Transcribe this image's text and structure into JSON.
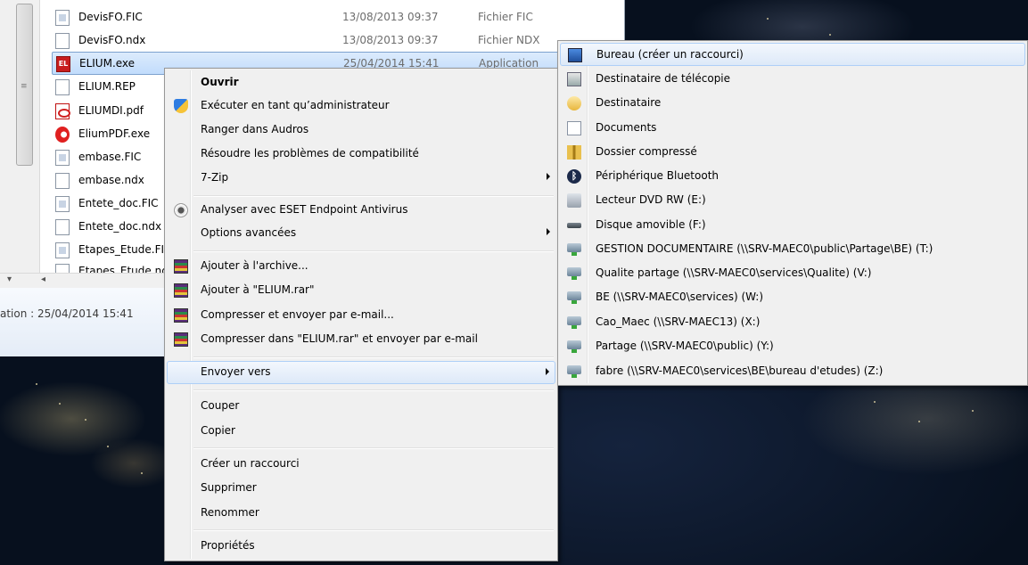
{
  "explorer": {
    "files": [
      {
        "name": "DevisFO.FIC",
        "date": "13/08/2013 09:37",
        "type": "Fichier FIC",
        "icon": "fic-file-icon"
      },
      {
        "name": "DevisFO.ndx",
        "date": "13/08/2013 09:37",
        "type": "Fichier NDX",
        "icon": "blank-file-icon"
      },
      {
        "name": "ELIUM.exe",
        "date": "25/04/2014 15:41",
        "type": "Application",
        "icon": "elium-app-icon"
      },
      {
        "name": "ELIUM.REP",
        "date": "",
        "type": "",
        "icon": "blank-file-icon"
      },
      {
        "name": "ELIUMDI.pdf",
        "date": "",
        "type": "",
        "icon": "pdf-file-icon"
      },
      {
        "name": "EliumPDF.exe",
        "date": "",
        "type": "",
        "icon": "eliumpdf-app-icon"
      },
      {
        "name": "embase.FIC",
        "date": "",
        "type": "",
        "icon": "fic-file-icon"
      },
      {
        "name": "embase.ndx",
        "date": "",
        "type": "",
        "icon": "blank-file-icon"
      },
      {
        "name": "Entete_doc.FIC",
        "date": "",
        "type": "",
        "icon": "fic-file-icon"
      },
      {
        "name": "Entete_doc.ndx",
        "date": "",
        "type": "",
        "icon": "blank-file-icon"
      },
      {
        "name": "Etapes_Etude.FIC",
        "date": "",
        "type": "",
        "icon": "fic-file-icon"
      },
      {
        "name": "Etapes_Etude.ndx",
        "date": "",
        "type": "",
        "icon": "blank-file-icon"
      }
    ],
    "details_text": "ation : 25/04/2014 15:41"
  },
  "context_menu": {
    "items": [
      {
        "label": "Ouvrir",
        "bold": true
      },
      {
        "label": "Exécuter en tant qu’administrateur",
        "icon": "uac-shield-icon"
      },
      {
        "label": "Ranger dans Audros"
      },
      {
        "label": "Résoudre les problèmes de compatibilité"
      },
      {
        "label": "7-Zip",
        "submenu": true
      },
      {
        "label": "Analyser avec ESET Endpoint Antivirus",
        "icon": "eset-icon"
      },
      {
        "label": "Options avancées",
        "submenu": true
      },
      {
        "label": "Ajouter à l'archive...",
        "icon": "winrar-icon"
      },
      {
        "label": "Ajouter à \"ELIUM.rar\"",
        "icon": "winrar-icon"
      },
      {
        "label": "Compresser et envoyer par e-mail...",
        "icon": "winrar-icon"
      },
      {
        "label": "Compresser dans \"ELIUM.rar\" et envoyer par e-mail",
        "icon": "winrar-icon"
      },
      {
        "label": "Envoyer vers",
        "submenu": true,
        "highlighted": true
      },
      {
        "label": "Couper"
      },
      {
        "label": "Copier"
      },
      {
        "label": "Créer un raccourci"
      },
      {
        "label": "Supprimer"
      },
      {
        "label": "Renommer"
      },
      {
        "label": "Propriétés"
      }
    ]
  },
  "send_to_menu": {
    "items": [
      {
        "label": "Bureau (créer un raccourci)",
        "icon": "desktop-icon",
        "highlighted": true
      },
      {
        "label": "Destinataire de télécopie",
        "icon": "fax-icon"
      },
      {
        "label": "Destinataire",
        "icon": "mail-recipient-icon"
      },
      {
        "label": "Documents",
        "icon": "documents-icon"
      },
      {
        "label": "Dossier compressé",
        "icon": "zip-folder-icon"
      },
      {
        "label": "Périphérique Bluetooth",
        "icon": "bluetooth-icon"
      },
      {
        "label": "Lecteur DVD RW (E:)",
        "icon": "dvd-drive-icon"
      },
      {
        "label": "Disque amovible (F:)",
        "icon": "removable-disk-icon"
      },
      {
        "label": "GESTION DOCUMENTAIRE (\\\\SRV-MAEC0\\public\\Partage\\BE) (T:)",
        "icon": "network-drive-icon"
      },
      {
        "label": "Qualite partage (\\\\SRV-MAEC0\\services\\Qualite) (V:)",
        "icon": "network-drive-icon"
      },
      {
        "label": "BE (\\\\SRV-MAEC0\\services) (W:)",
        "icon": "network-drive-icon"
      },
      {
        "label": "Cao_Maec (\\\\SRV-MAEC13) (X:)",
        "icon": "network-drive-icon"
      },
      {
        "label": "Partage (\\\\SRV-MAEC0\\public) (Y:)",
        "icon": "network-drive-icon"
      },
      {
        "label": "fabre (\\\\SRV-MAEC0\\services\\BE\\bureau d'etudes) (Z:)",
        "icon": "network-drive-icon"
      }
    ]
  },
  "colors": {
    "menu_bg": "#f0f0f0",
    "highlight_border": "#aecff7",
    "selection": "#c1dcfc",
    "desktop": "#0b1628"
  }
}
